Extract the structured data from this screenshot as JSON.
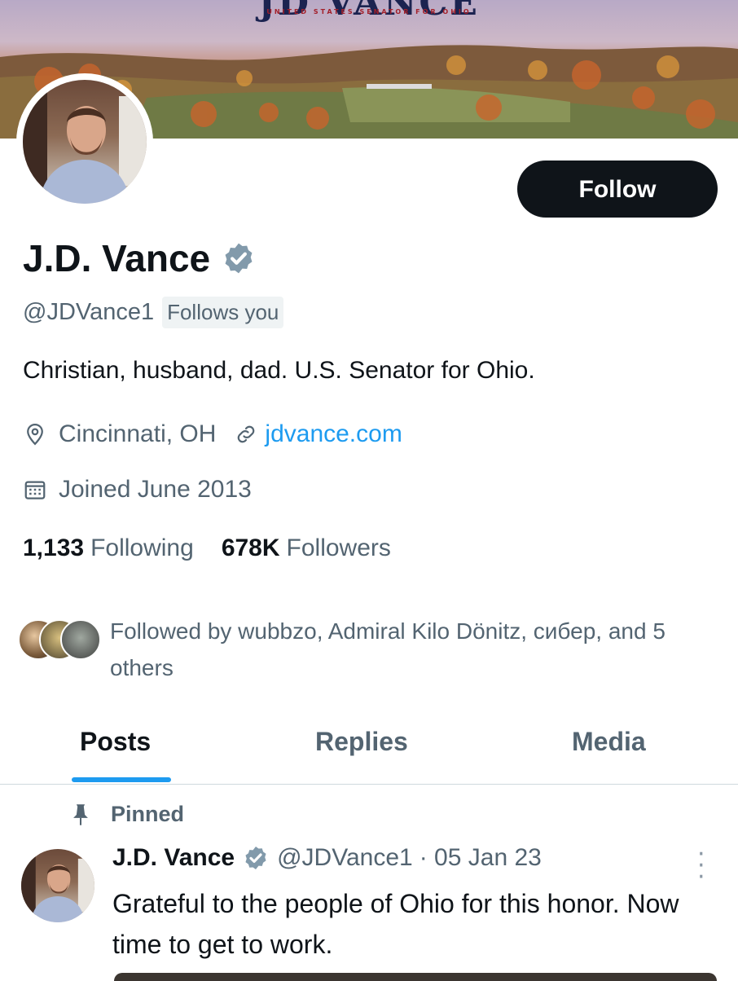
{
  "banner": {
    "title": "JD VANCE",
    "subtitle": "UNITED STATES SENATOR FOR OHIO"
  },
  "profile": {
    "follow_label": "Follow",
    "name": "J.D. Vance",
    "handle": "@JDVance1",
    "follows_you": "Follows you",
    "bio": "Christian, husband, dad. U.S. Senator for Ohio.",
    "location": "Cincinnati, OH",
    "website": "jdvance.com",
    "joined": "Joined June 2013",
    "following_count": "1,133",
    "following_label": "Following",
    "followers_count": "678K",
    "followers_label": "Followers",
    "followed_by": "Followed by wubbzo, Admiral Kilo Dönitz, сибер, and 5 others"
  },
  "tabs": [
    {
      "label": "Posts",
      "active": true
    },
    {
      "label": "Replies",
      "active": false
    },
    {
      "label": "Media",
      "active": false
    }
  ],
  "pinned_post": {
    "pinned_label": "Pinned",
    "author_name": "J.D. Vance",
    "author_handle": "@JDVance1",
    "date": "· 05 Jan 23",
    "text": "Grateful to the people of Ohio for this honor. Now time to get to work."
  },
  "colors": {
    "accent": "#1d9bf0",
    "text_primary": "#0f1419",
    "text_secondary": "#536471",
    "verified_badge": "#829aab"
  },
  "icons": {
    "verified": "verified-badge-icon",
    "location": "location-pin-icon",
    "link": "link-icon",
    "calendar": "calendar-icon",
    "pin": "pin-icon",
    "more": "more-vertical-icon"
  }
}
